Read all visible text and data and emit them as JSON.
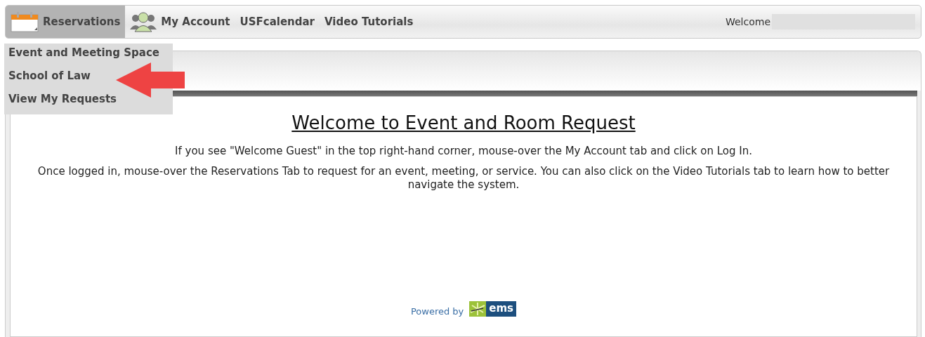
{
  "nav": {
    "tabs": [
      {
        "label": "Reservations",
        "kind": "calendar",
        "selected": true
      },
      {
        "label": "My Account",
        "kind": "people",
        "selected": false
      },
      {
        "label": "USFcalendar",
        "kind": "plain",
        "selected": false
      },
      {
        "label": "Video Tutorials",
        "kind": "plain",
        "selected": false
      }
    ],
    "welcome": "Welcome"
  },
  "dropdown": {
    "items": [
      {
        "label": "Event and Meeting Space",
        "pointed": false
      },
      {
        "label": "School of Law",
        "pointed": true
      },
      {
        "label": "View My Requests",
        "pointed": false
      }
    ]
  },
  "content": {
    "title": "Welcome to Event and Room Request",
    "paragraphs": [
      "If you see \"Welcome Guest\" in the top right-hand corner, mouse-over the My Account tab and click on Log In.",
      "Once logged in, mouse-over the Reservations Tab to request for an event, meeting, or service. You can also click on the Video Tutorials tab to learn how to better navigate the system."
    ],
    "powered_by": "Powered by",
    "logo_text": "ems"
  }
}
